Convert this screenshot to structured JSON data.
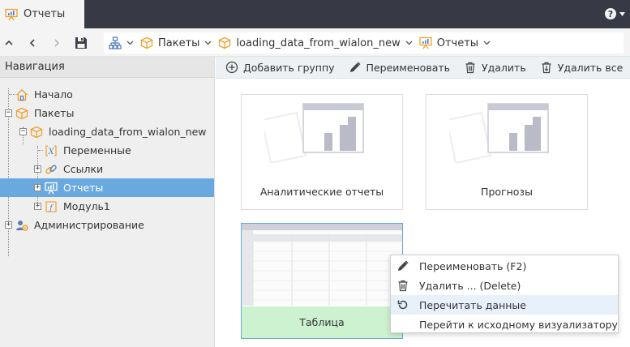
{
  "tab": {
    "title": "Отчеты"
  },
  "help": {
    "icon": "help-icon"
  },
  "toolbar": {
    "buttons": [
      "chevron-up-icon",
      "chevron-left-icon",
      "chevron-right-icon",
      "save-icon"
    ],
    "breadcrumb": [
      {
        "icon": "hierarchy-icon",
        "label": ""
      },
      {
        "icon": "package-icon",
        "label": "Пакеты"
      },
      {
        "icon": "package-icon",
        "label": "loading_data_from_wialon_new"
      },
      {
        "icon": "report-icon",
        "label": "Отчеты"
      }
    ]
  },
  "nav": {
    "header": "Навигация",
    "items": [
      {
        "label": "Начало",
        "icon": "home-icon"
      },
      {
        "label": "Пакеты",
        "icon": "package-icon"
      },
      {
        "label": "loading_data_from_wialon_new",
        "icon": "package-icon"
      },
      {
        "label": "Переменные",
        "icon": "variable-icon"
      },
      {
        "label": "Ссылки",
        "icon": "link-icon"
      },
      {
        "label": "Отчеты",
        "icon": "report-icon"
      },
      {
        "label": "Модуль1",
        "icon": "module-icon"
      },
      {
        "label": "Администрирование",
        "icon": "admin-icon"
      }
    ],
    "selected": "Отчеты"
  },
  "actions": [
    {
      "label": "Добавить группу",
      "icon": "add-circle-icon"
    },
    {
      "label": "Переименовать",
      "icon": "pencil-icon"
    },
    {
      "label": "Удалить",
      "icon": "trash-icon"
    },
    {
      "label": "Удалить все",
      "icon": "trash-all-icon"
    }
  ],
  "cards": [
    {
      "label": "Аналитические отчеты",
      "icon": "chart-folder-icon"
    },
    {
      "label": "Прогнозы",
      "icon": "chart-folder-icon"
    },
    {
      "label": "Таблица",
      "icon": "table-preview-icon"
    }
  ],
  "context_menu": {
    "items": [
      {
        "label": "Переименовать (F2)",
        "icon": "pencil-icon"
      },
      {
        "label": "Удалить ... (Delete)",
        "icon": "trash-icon"
      },
      {
        "label": "Перечитать данные",
        "icon": "refresh-icon"
      },
      {
        "label": "Перейти к исходному визуализатору",
        "icon": ""
      }
    ],
    "highlighted": "Перечитать данные"
  },
  "colors": {
    "topbar": "#373a44",
    "selection": "#6aa9e0",
    "table_card_footer": "#cdf2d0",
    "icon_orange": "#f0a030"
  }
}
